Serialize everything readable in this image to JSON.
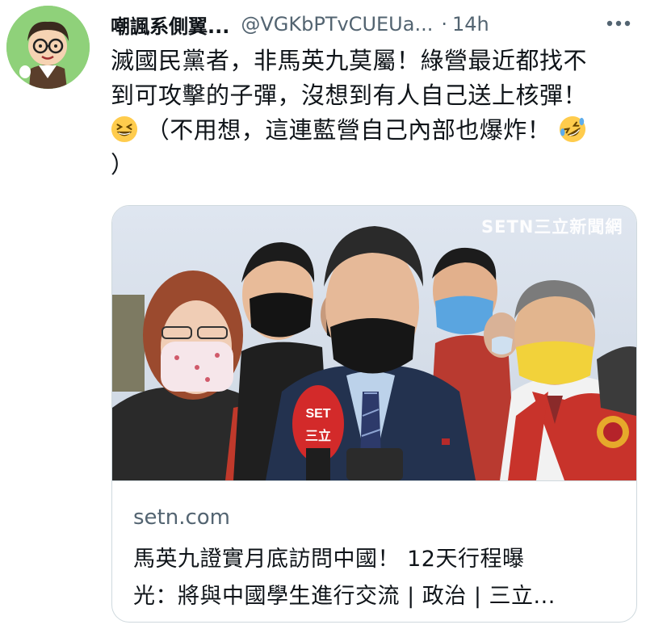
{
  "tweet": {
    "author_name": "嘲諷系側翼...",
    "author_handle": "@VGKbPTvCUEUa...",
    "separator": "·",
    "time": "14h",
    "text_line1": "滅國民黨者，非馬英九莫屬！綠營最近都找不",
    "text_line2": "到可攻擊的子彈，沒想到有人自己送上核彈！",
    "text_line3": "（不用想，這連藍營自己內部也爆炸！",
    "text_line4": "）"
  },
  "card": {
    "watermark": "SETN三立新聞網",
    "mic_logo_top": "SET",
    "mic_logo_bottom": "三立",
    "domain": "setn.com",
    "title_line1": "馬英九證實月底訪問中國！ 12天行程曝",
    "title_line2": "光：將與中國學生進行交流 | 政治 | 三立..."
  },
  "icons": {
    "more": "more-horizontal-icon",
    "emoji1": "grinning-squinting-face-icon",
    "emoji2": "rolling-on-floor-laughing-icon"
  },
  "colors": {
    "avatar_bg": "#8fd17a",
    "secondary_text": "#536471",
    "border": "#cfd9de"
  }
}
